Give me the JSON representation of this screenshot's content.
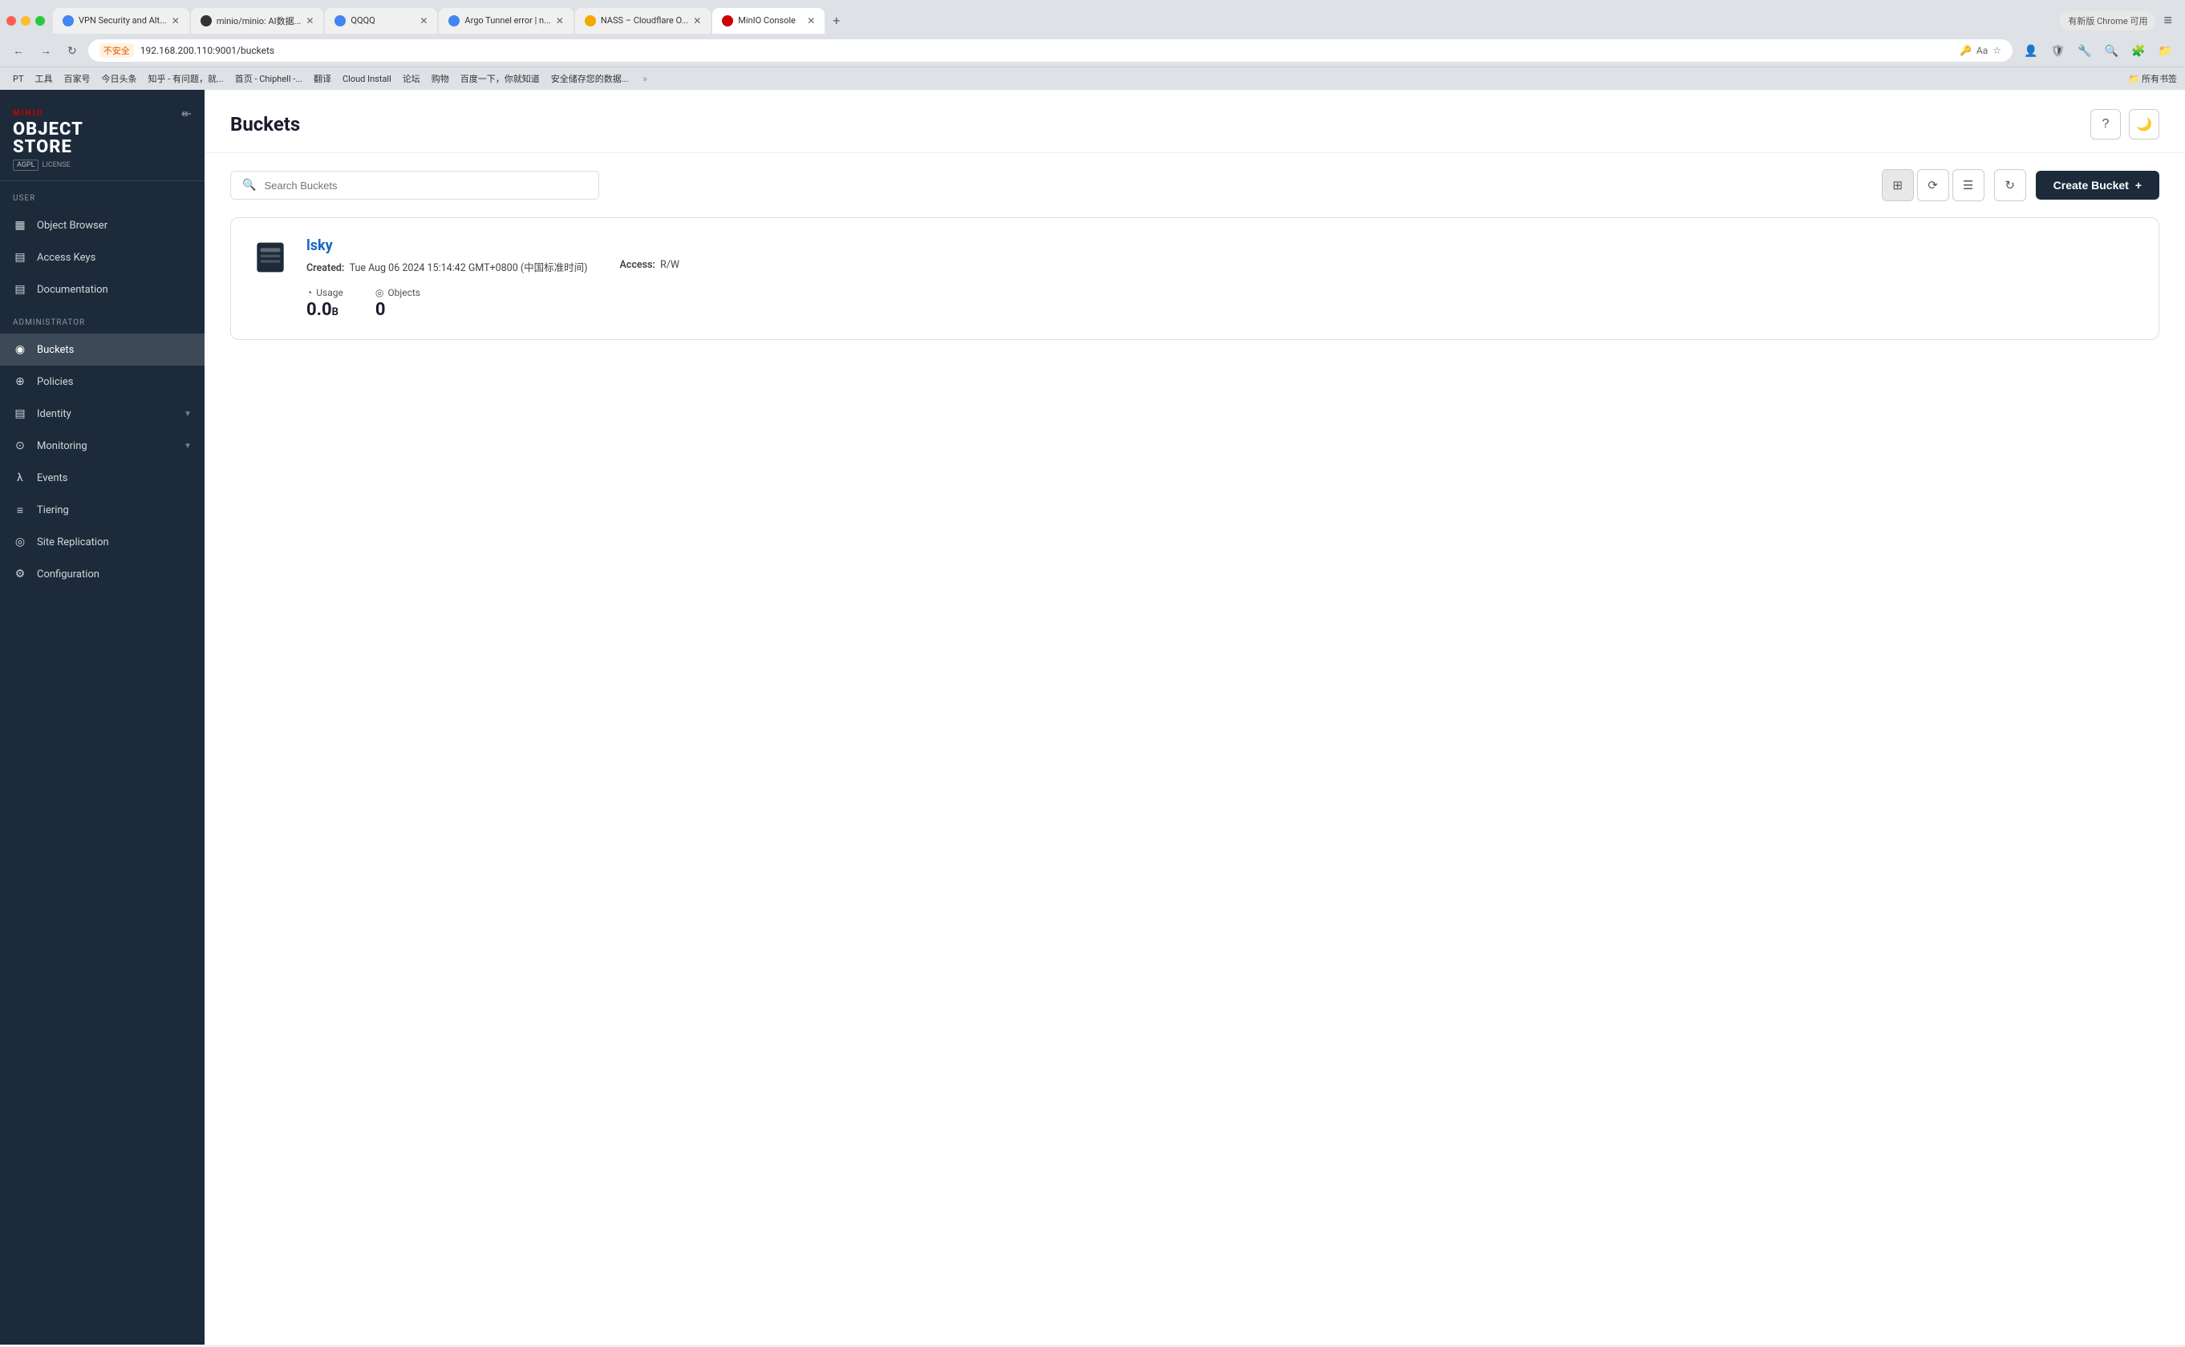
{
  "browser": {
    "tabs": [
      {
        "id": "vpn",
        "label": "VPN Security and Alt...",
        "active": false,
        "color": "#4285f4"
      },
      {
        "id": "minio-github",
        "label": "minio/minio: AI数据...",
        "active": false,
        "color": "#333"
      },
      {
        "id": "qqqq",
        "label": "QQQQ",
        "active": false,
        "color": "#4285f4"
      },
      {
        "id": "argo",
        "label": "Argo Tunnel error | n...",
        "active": false,
        "color": "#4285f4"
      },
      {
        "id": "nass",
        "label": "NASS – Cloudflare O...",
        "active": false,
        "color": "#f4a900"
      },
      {
        "id": "minio-console",
        "label": "MinIO Console",
        "active": true,
        "color": "#c00"
      }
    ],
    "address": "192.168.200.110:9001/buckets",
    "warning": "不安全",
    "new_version": "有新版 Chrome 可用"
  },
  "bookmarks": [
    "PT",
    "工具",
    "百家号",
    "今日头条",
    "知乎 - 有问题，就...",
    "首页 - Chiphell -...",
    "翻译",
    "Cloud Install",
    "论坛",
    "购物",
    "百度一下，你就知道",
    "安全储存您的数据..."
  ],
  "sidebar": {
    "logo": {
      "brand": "MINIO",
      "title": "OBJECT STORE",
      "badge": "AGPL",
      "license": "LICENSE"
    },
    "user_section": "User",
    "admin_section": "Administrator",
    "user_items": [
      {
        "id": "object-browser",
        "label": "Object Browser",
        "icon": "▦"
      },
      {
        "id": "access-keys",
        "label": "Access Keys",
        "icon": "▤"
      },
      {
        "id": "documentation",
        "label": "Documentation",
        "icon": "▤"
      }
    ],
    "admin_items": [
      {
        "id": "buckets",
        "label": "Buckets",
        "icon": "◉",
        "active": true
      },
      {
        "id": "policies",
        "label": "Policies",
        "icon": "⊕"
      },
      {
        "id": "identity",
        "label": "Identity",
        "icon": "▤",
        "has_chevron": true
      },
      {
        "id": "monitoring",
        "label": "Monitoring",
        "icon": "⊙",
        "has_chevron": true
      },
      {
        "id": "events",
        "label": "Events",
        "icon": "λ"
      },
      {
        "id": "tiering",
        "label": "Tiering",
        "icon": "≡"
      },
      {
        "id": "site-replication",
        "label": "Site Replication",
        "icon": "⊙"
      },
      {
        "id": "configuration",
        "label": "Configuration",
        "icon": "⚙"
      }
    ]
  },
  "main": {
    "title": "Buckets",
    "search_placeholder": "Search Buckets",
    "create_bucket_label": "Create Bucket",
    "bucket": {
      "name": "lsky",
      "created_label": "Created:",
      "created_value": "Tue Aug 06 2024 15:14:42 GMT+0800 (中国标准时间)",
      "access_label": "Access:",
      "access_value": "R/W",
      "usage_label": "Usage",
      "usage_value": "0.0",
      "usage_unit": "B",
      "objects_label": "Objects",
      "objects_value": "0"
    }
  }
}
